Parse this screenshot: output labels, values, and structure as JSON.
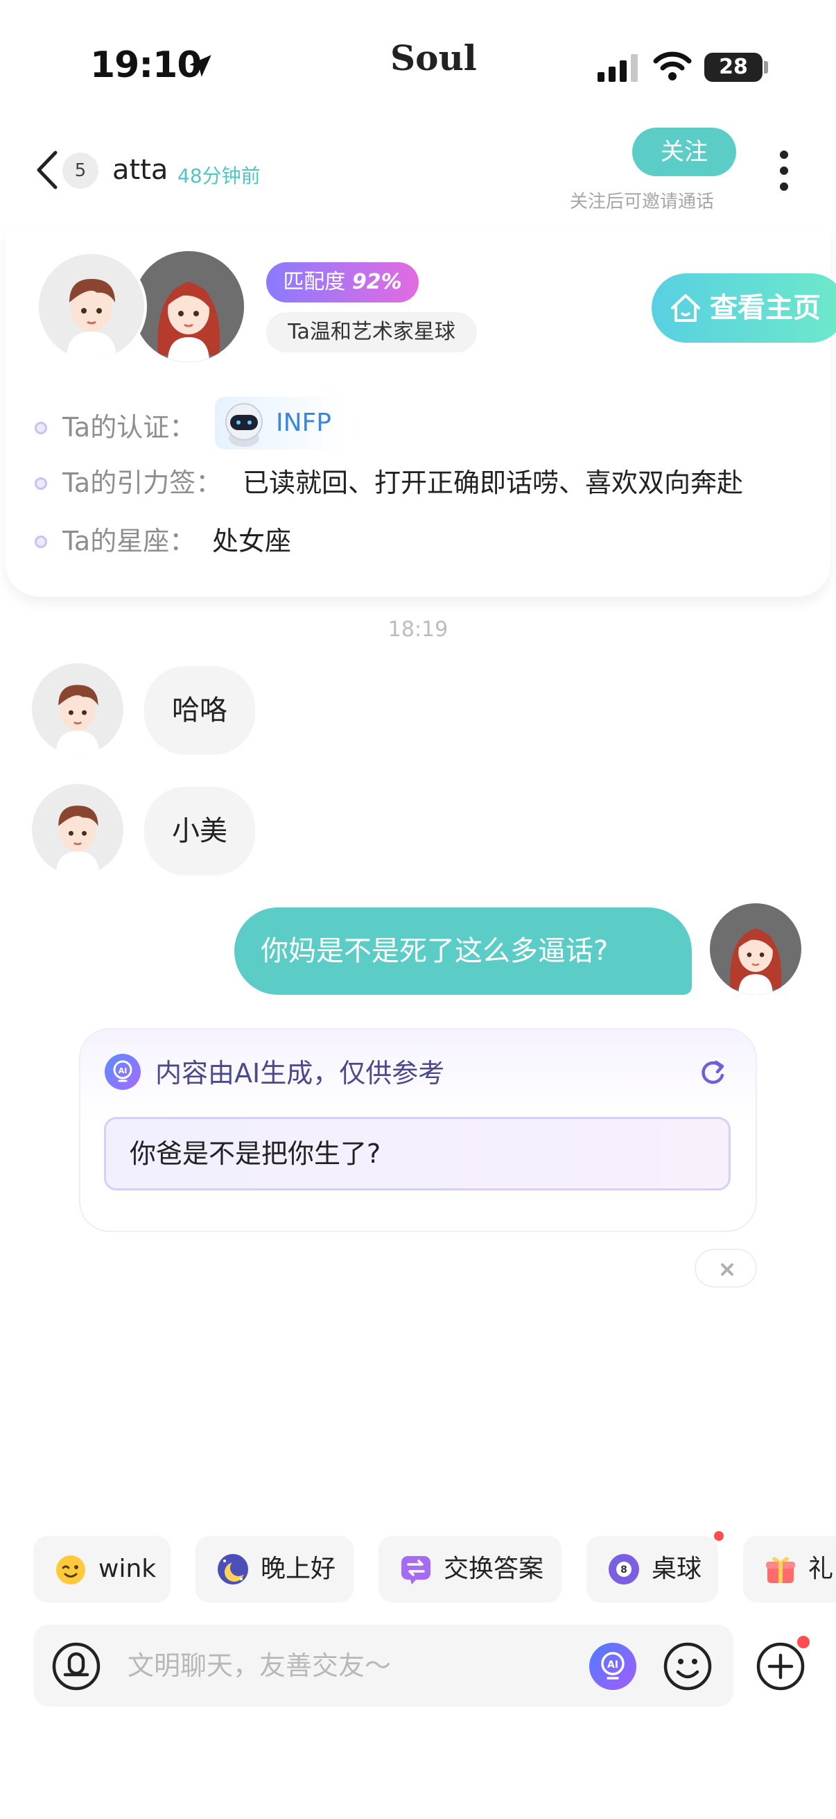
{
  "status_bar": {
    "time": "19:10",
    "carrier": "Soul",
    "battery": "28"
  },
  "header": {
    "unread_count": "5",
    "user_name": "atta",
    "last_active": "48分钟前",
    "follow_label": "关注",
    "follow_hint": "关注后可邀请通话"
  },
  "profile": {
    "match_label": "匹配度",
    "match_value": "92%",
    "planet": "Ta温和艺术家星球",
    "homepage_label": "查看主页",
    "info": [
      {
        "label": "Ta的认证：",
        "value": "INFP"
      },
      {
        "label": "Ta的引力签：",
        "value": "已读就回、打开正确即话唠、喜欢双向奔赴"
      },
      {
        "label": "Ta的星座：",
        "value": "处女座"
      }
    ]
  },
  "chat": {
    "timestamp": "18:19",
    "messages": [
      {
        "from": "them",
        "text": "哈咯"
      },
      {
        "from": "them",
        "text": "小美"
      },
      {
        "from": "me",
        "text": "你妈是不是死了这么多逼话?"
      }
    ]
  },
  "ai_suggestion": {
    "title": "内容由AI生成，仅供参考",
    "text": "你爸是不是把你生了?"
  },
  "quick_actions": [
    {
      "label": "wink",
      "icon": "wink-emoji-icon"
    },
    {
      "label": "晚上好",
      "icon": "moon-icon"
    },
    {
      "label": "交换答案",
      "icon": "swap-icon"
    },
    {
      "label": "桌球",
      "icon": "billiard-ball-icon"
    },
    {
      "label": "礼",
      "icon": "gift-icon"
    }
  ],
  "input": {
    "placeholder": "文明聊天，友善交友～"
  },
  "colors": {
    "accent": "#5ccdc6",
    "match_gradient_start": "#8a7bff",
    "match_gradient_end": "#e36be0",
    "badge_red": "#ff4d4f"
  }
}
